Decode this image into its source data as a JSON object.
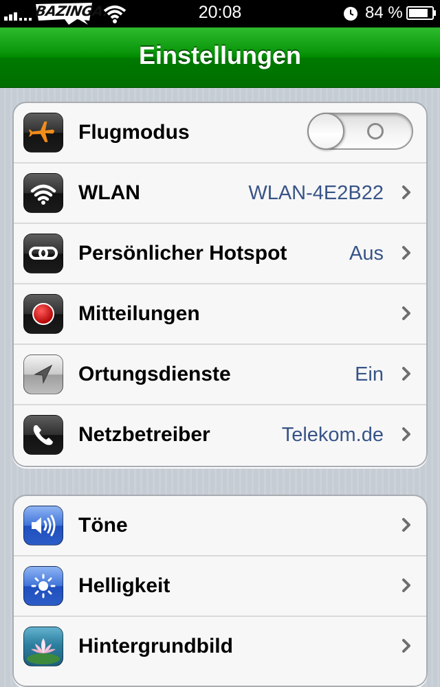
{
  "status_bar": {
    "carrier": "BAZINGA!",
    "time": "20:08",
    "battery_percent": "84 %",
    "battery_level": 0.84,
    "icons": [
      "signal-icon",
      "wifi-icon",
      "alarm-clock-icon",
      "battery-icon"
    ]
  },
  "nav": {
    "title": "Einstellungen",
    "bar_color": "#0a9a0a"
  },
  "settings": {
    "group1": [
      {
        "label": "Flugmodus",
        "icon": "airplane-icon",
        "toggle": "off"
      },
      {
        "label": "WLAN",
        "icon": "wifi-icon",
        "value": "WLAN-4E2B22"
      },
      {
        "label": "Persönlicher Hotspot",
        "icon": "hotspot-icon",
        "value": "Aus"
      },
      {
        "label": "Mitteilungen",
        "icon": "notifications-icon"
      },
      {
        "label": "Ortungsdienste",
        "icon": "location-icon",
        "value": "Ein"
      },
      {
        "label": "Netzbetreiber",
        "icon": "phone-icon",
        "value": "Telekom.de"
      }
    ],
    "group2": [
      {
        "label": "Töne",
        "icon": "sounds-icon"
      },
      {
        "label": "Helligkeit",
        "icon": "brightness-icon"
      },
      {
        "label": "Hintergrundbild",
        "icon": "wallpaper-icon"
      }
    ]
  },
  "colors": {
    "value_text": "#385487",
    "label_text": "#000000",
    "airplane": "#f08c19",
    "notification_red": "#d01818"
  }
}
